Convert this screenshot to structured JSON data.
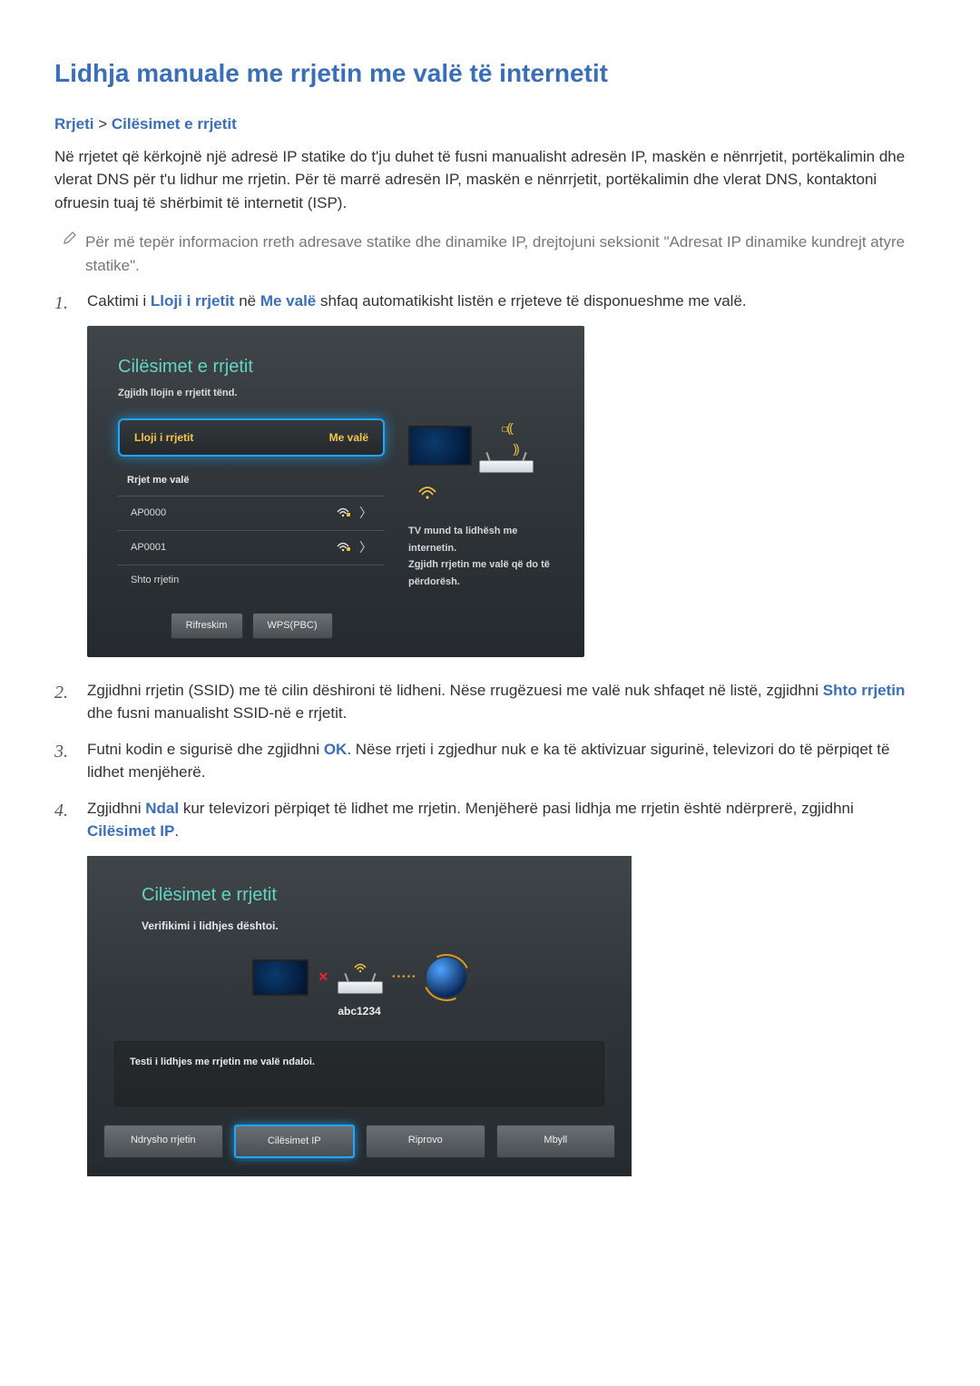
{
  "page": {
    "title": "Lidhja manuale me rrjetin me valë të internetit",
    "breadcrumb_a": "Rrjeti",
    "breadcrumb_sep": " > ",
    "breadcrumb_b": "Cilësimet e rrjetit",
    "intro": "Në rrjetet që kërkojnë një adresë IP statike do t'ju duhet të fusni manualisht adresën IP, maskën e nënrrjetit, portëkalimin dhe vlerat DNS për t'u lidhur me rrjetin. Për të marrë adresën IP, maskën e nënrrjetit, portëkalimin dhe vlerat DNS, kontaktoni ofruesin tuaj të shërbimit të internetit (ISP).",
    "note": "Për më tepër informacion rreth adresave statike dhe dinamike IP, drejtojuni seksionit \"Adresat IP dinamike kundrejt atyre statike\"."
  },
  "steps": {
    "s1_a": "Caktimi i ",
    "s1_kw1": "Lloji i rrjetit",
    "s1_b": " në ",
    "s1_kw2": "Me valë",
    "s1_c": " shfaq automatikisht listën e rrjeteve të disponueshme me valë.",
    "s2_a": "Zgjidhni rrjetin (SSID) me të cilin dëshironi të lidheni. Nëse rrugëzuesi me valë nuk shfaqet në listë, zgjidhni ",
    "s2_kw": "Shto rrjetin",
    "s2_b": " dhe fusni manualisht SSID-në e rrjetit.",
    "s3_a": "Futni kodin e sigurisë dhe zgjidhni ",
    "s3_kw": "OK",
    "s3_b": ". Nëse rrjeti i zgjedhur nuk e ka të aktivizuar sigurinë, televizori do të përpiqet të lidhet menjëherë.",
    "s4_a": "Zgjidhni ",
    "s4_kw1": "Ndal",
    "s4_b": " kur televizori përpiqet të lidhet me rrjetin. Menjëherë pasi lidhja me rrjetin është ndërprerë, zgjidhni ",
    "s4_kw2": "Cilësimet IP",
    "s4_c": "."
  },
  "tv1": {
    "title": "Cilësimet e rrjetit",
    "subtitle": "Zgjidh llojin e rrjetit tënd.",
    "field_label": "Lloji i rrjetit",
    "field_value": "Me valë",
    "section": "Rrjet me valë",
    "ap0": "AP0000",
    "ap1": "AP0001",
    "add": "Shto rrjetin",
    "btn_refresh": "Rifreskim",
    "btn_wps": "WPS(PBC)",
    "right1": "TV mund ta lidhësh me internetin.",
    "right2": "Zgjidh rrjetin me valë që do të përdorësh."
  },
  "tv2": {
    "title": "Cilësimet e rrjetit",
    "subtitle": "Verifikimi i lidhjes dështoi.",
    "ssid": "abc1234",
    "msg": "Testi i lidhjes me rrjetin me valë ndaloi.",
    "btn_change": "Ndrysho rrjetin",
    "btn_ip": "Cilësimet IP",
    "btn_retry": "Riprovo",
    "btn_close": "Mbyll"
  }
}
